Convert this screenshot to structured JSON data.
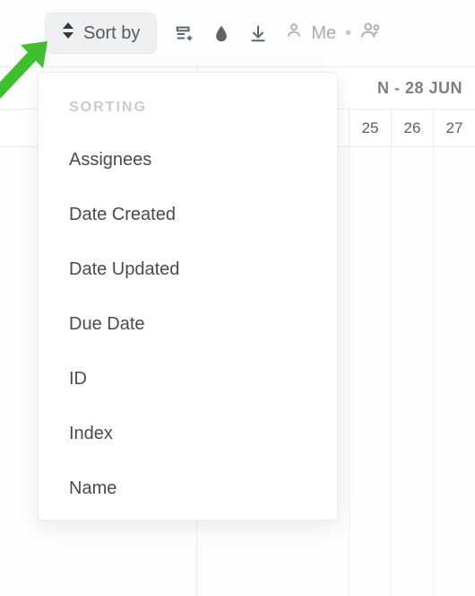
{
  "toolbar": {
    "sort_label": "Sort by",
    "me_label": "Me"
  },
  "calendar": {
    "range_label": "N - 28 JUN",
    "days": [
      "25",
      "26",
      "27"
    ]
  },
  "dropdown": {
    "heading": "SORTING",
    "items": [
      "Assignees",
      "Date Created",
      "Date Updated",
      "Due Date",
      "ID",
      "Index",
      "Name"
    ]
  }
}
